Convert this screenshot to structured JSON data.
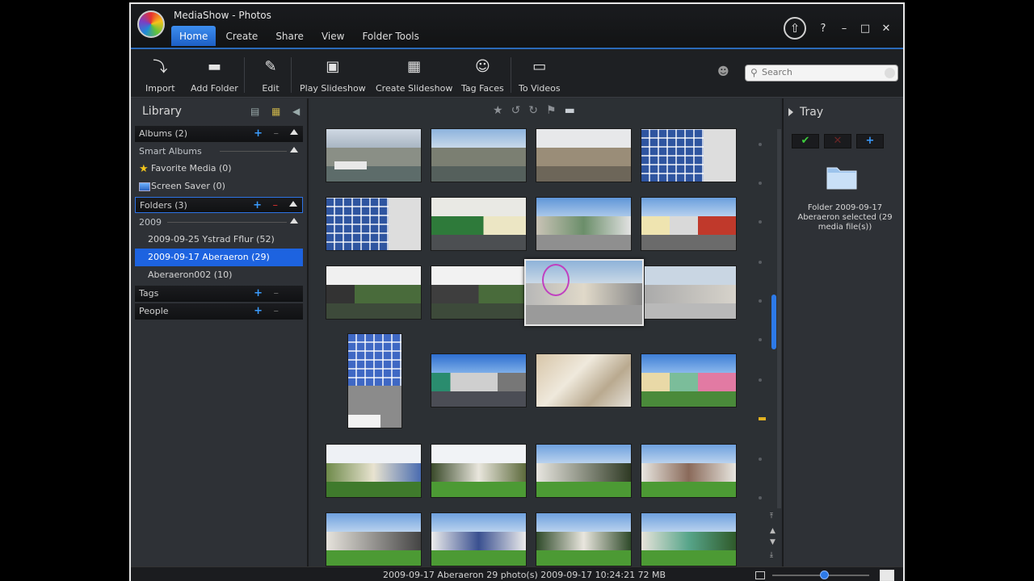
{
  "app": {
    "title": "MediaShow - Photos"
  },
  "menu": [
    {
      "label": "Home"
    },
    {
      "label": "Create"
    },
    {
      "label": "Share"
    },
    {
      "label": "View"
    },
    {
      "label": "Folder Tools"
    }
  ],
  "window_controls": {
    "help": "?",
    "minimize": "–",
    "maximize": "□",
    "close": "✕"
  },
  "toolbar": {
    "import": "Import",
    "add_folder": "Add Folder",
    "edit": "Edit",
    "play_slideshow": "Play Slideshow",
    "create_slideshow": "Create Slideshow",
    "tag_faces": "Tag Faces",
    "to_videos": "To Videos"
  },
  "search": {
    "placeholder": "Search",
    "value": ""
  },
  "library": {
    "title": "Library",
    "albums": "Albums (2)",
    "smart_albums": "Smart Albums",
    "favorite_media": "Favorite Media (0)",
    "screen_saver": "Screen Saver (0)",
    "folders": "Folders (3)",
    "year": "2009",
    "folder_items": [
      {
        "label": "2009-09-25 Ystrad Fflur (52)"
      },
      {
        "label": "2009-09-17 Aberaeron (29)"
      },
      {
        "label": "Aberaeron002 (10)"
      }
    ],
    "tags": "Tags",
    "people": "People"
  },
  "tray": {
    "title": "Tray",
    "info": "Folder 2009-09-17 Aberaeron selected (29 media file(s))"
  },
  "status": {
    "text": "2009-09-17 Aberaeron  29 photo(s)  2009-09-17 10:24:21  72 MB"
  },
  "colors": {
    "accent": "#1d63e0",
    "selection_blue": "#2d7ae8",
    "favorite_star": "#f3c51b"
  }
}
